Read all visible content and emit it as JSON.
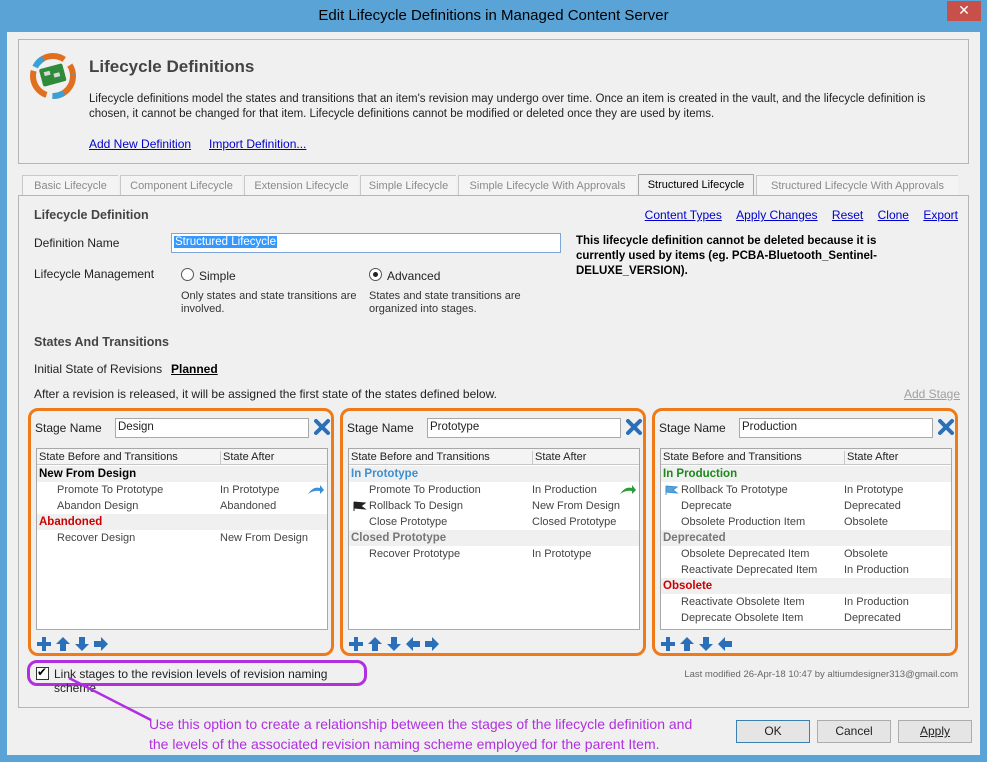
{
  "window": {
    "title": "Edit Lifecycle Definitions in Managed Content Server",
    "close_glyph": "✕"
  },
  "header": {
    "title": "Lifecycle Definitions",
    "description": "Lifecycle definitions model the states and transitions that an item's revision may undergo over time. Once an item is created in the vault, and the lifecycle definition is chosen, it cannot be changed for that item. Lifecycle definitions cannot be modified or deleted once they are used by items.",
    "link_add": "Add New Definition",
    "link_import": "Import Definition..."
  },
  "tabs": [
    {
      "label": "Basic Lifecycle"
    },
    {
      "label": "Component Lifecycle"
    },
    {
      "label": "Extension Lifecycle"
    },
    {
      "label": "Simple Lifecycle"
    },
    {
      "label": "Simple Lifecycle With Approvals"
    },
    {
      "label": "Structured Lifecycle"
    },
    {
      "label": "Structured Lifecycle With Approvals"
    }
  ],
  "definition": {
    "section_title": "Lifecycle Definition",
    "links": {
      "content_types": "Content Types",
      "apply_changes": "Apply Changes",
      "reset": "Reset",
      "clone": "Clone",
      "export": "Export"
    },
    "name_label": "Definition Name",
    "name_value": "Structured Lifecycle",
    "warning": "This lifecycle definition cannot be deleted because it is currently used by items (eg. PCBA-Bluetooth_Sentinel-DELUXE_VERSION).",
    "management_label": "Lifecycle Management",
    "simple_label": "Simple",
    "simple_desc": "Only states and state transitions are involved.",
    "advanced_label": "Advanced",
    "advanced_desc": "States and state transitions are organized into stages."
  },
  "states": {
    "section_title": "States And Transitions",
    "initial_label": "Initial State of Revisions",
    "initial_value": "Planned",
    "release_note": "After a revision is released, it will be assigned the first state of the states defined below.",
    "add_stage": "Add Stage",
    "col_before": "State Before and Transitions",
    "col_after": "State After",
    "stage_name_label": "Stage Name"
  },
  "stages": [
    {
      "name": "Design",
      "rows": [
        {
          "type": "state",
          "text": "New From Design",
          "color": "#000000"
        },
        {
          "type": "trans",
          "before": "Promote To Prototype",
          "after": "In Prototype",
          "arrow": "blue-right"
        },
        {
          "type": "trans",
          "before": "Abandon Design",
          "after": "Abandoned"
        },
        {
          "type": "state",
          "text": "Abandoned",
          "color": "#cc0000"
        },
        {
          "type": "trans",
          "before": "Recover Design",
          "after": "New From Design"
        }
      ]
    },
    {
      "name": "Prototype",
      "rows": [
        {
          "type": "state",
          "text": "In Prototype",
          "color": "#3c8fd0"
        },
        {
          "type": "trans",
          "before": "Promote To Production",
          "after": "In Production",
          "arrow": "green-right"
        },
        {
          "type": "trans",
          "before": "Rollback To Design",
          "after": "New From Design",
          "flag": "black"
        },
        {
          "type": "trans",
          "before": "Close Prototype",
          "after": "Closed Prototype"
        },
        {
          "type": "state",
          "text": "Closed Prototype",
          "color": "#777777"
        },
        {
          "type": "trans",
          "before": "Recover Prototype",
          "after": "In Prototype"
        }
      ]
    },
    {
      "name": "Production",
      "rows": [
        {
          "type": "state",
          "text": "In Production",
          "color": "#1a8a1a"
        },
        {
          "type": "trans",
          "before": "Rollback To Prototype",
          "after": "In Prototype",
          "flag": "blue"
        },
        {
          "type": "trans",
          "before": "Deprecate",
          "after": "Deprecated"
        },
        {
          "type": "trans",
          "before": "Obsolete Production Item",
          "after": "Obsolete"
        },
        {
          "type": "state",
          "text": "Deprecated",
          "color": "#777777"
        },
        {
          "type": "trans",
          "before": "Obsolete Deprecated Item",
          "after": "Obsolete"
        },
        {
          "type": "trans",
          "before": "Reactivate Deprecated Item",
          "after": "In Production"
        },
        {
          "type": "state",
          "text": "Obsolete",
          "color": "#cc0000"
        },
        {
          "type": "trans",
          "before": "Reactivate Obsolete Item",
          "after": "In Production"
        },
        {
          "type": "trans",
          "before": "Deprecate Obsolete Item",
          "after": "Deprecated"
        }
      ]
    }
  ],
  "link_stages_label": "Link stages to the revision levels of revision naming scheme",
  "last_modified": "Last modified 26-Apr-18 10:47 by altiumdesigner313@gmail.com",
  "callout": {
    "line1": "Use this option to create a relationship between the stages of the lifecycle definition and",
    "line2": "the levels of the associated revision naming scheme employed for the parent Item."
  },
  "buttons": {
    "ok": "OK",
    "cancel": "Cancel",
    "apply": "Apply"
  },
  "colors": {
    "stage_highlight": "#f07a18",
    "callout": "#b12fe0",
    "link": "#0000cc"
  }
}
